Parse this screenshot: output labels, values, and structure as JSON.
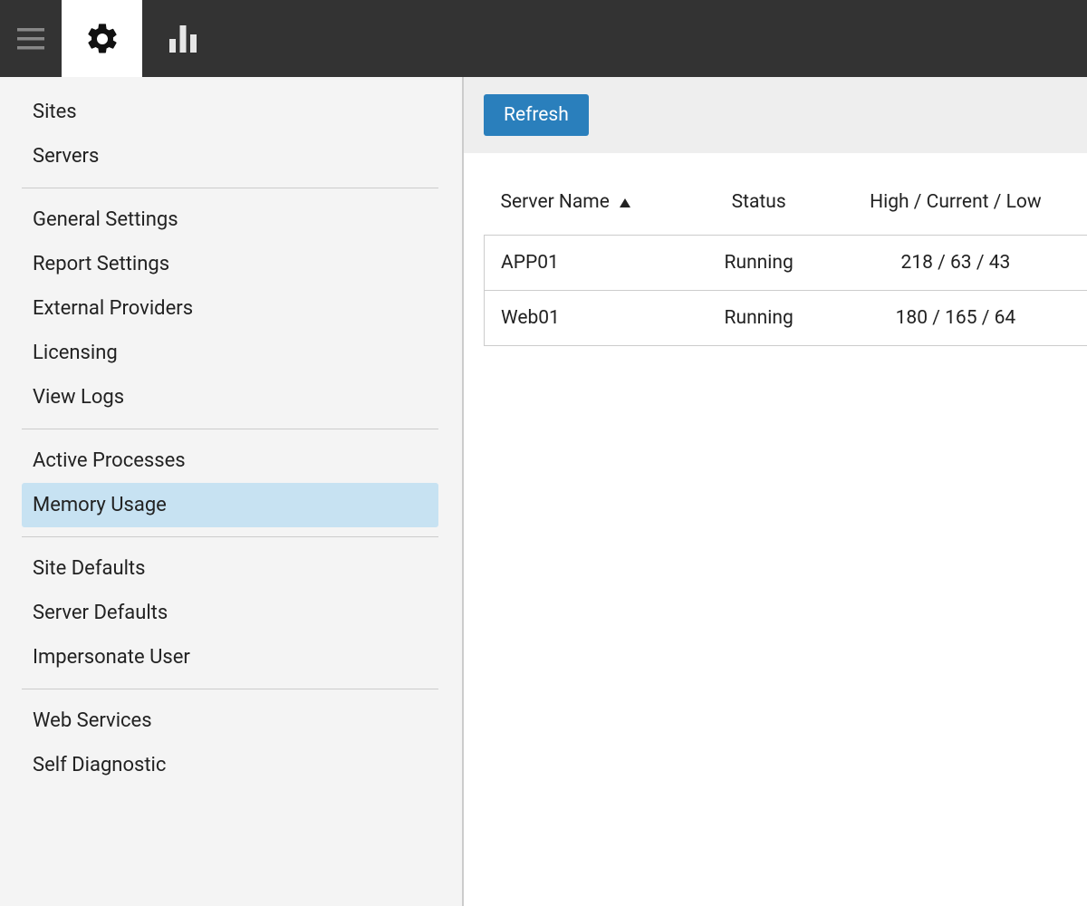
{
  "topbar": {
    "tabs": [
      {
        "id": "settings",
        "active": true
      },
      {
        "id": "stats",
        "active": false
      }
    ]
  },
  "sidebar": {
    "groups": [
      {
        "items": [
          {
            "id": "sites",
            "label": "Sites",
            "active": false
          },
          {
            "id": "servers",
            "label": "Servers",
            "active": false
          }
        ]
      },
      {
        "items": [
          {
            "id": "general-settings",
            "label": "General Settings",
            "active": false
          },
          {
            "id": "report-settings",
            "label": "Report Settings",
            "active": false
          },
          {
            "id": "external-providers",
            "label": "External Providers",
            "active": false
          },
          {
            "id": "licensing",
            "label": "Licensing",
            "active": false
          },
          {
            "id": "view-logs",
            "label": "View Logs",
            "active": false
          }
        ]
      },
      {
        "items": [
          {
            "id": "active-processes",
            "label": "Active Processes",
            "active": false
          },
          {
            "id": "memory-usage",
            "label": "Memory Usage",
            "active": true
          }
        ]
      },
      {
        "items": [
          {
            "id": "site-defaults",
            "label": "Site Defaults",
            "active": false
          },
          {
            "id": "server-defaults",
            "label": "Server Defaults",
            "active": false
          },
          {
            "id": "impersonate-user",
            "label": "Impersonate User",
            "active": false
          }
        ]
      },
      {
        "items": [
          {
            "id": "web-services",
            "label": "Web Services",
            "active": false
          },
          {
            "id": "self-diagnostic",
            "label": "Self Diagnostic",
            "active": false
          }
        ]
      }
    ]
  },
  "content": {
    "refresh_label": "Refresh",
    "columns": {
      "server_name": "Server Name",
      "status": "Status",
      "hcl": "High / Current / Low"
    },
    "sort": {
      "column": "server_name",
      "direction": "asc"
    },
    "rows": [
      {
        "server_name": "APP01",
        "status": "Running",
        "hcl": "218 / 63 / 43"
      },
      {
        "server_name": "Web01",
        "status": "Running",
        "hcl": "180 / 165 / 64"
      }
    ]
  },
  "colors": {
    "topbar_bg": "#333333",
    "sidebar_bg": "#f4f4f4",
    "active_item_bg": "#c7e2f2",
    "button_bg": "#2a7fbc",
    "border": "#cccccc",
    "text": "#222222"
  }
}
